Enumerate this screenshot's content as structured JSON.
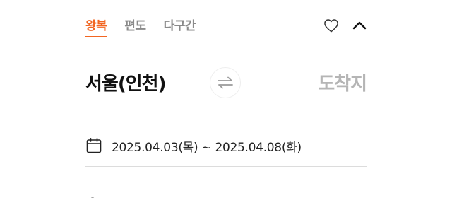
{
  "trip_tabs": [
    {
      "label": "왕복",
      "active": true
    },
    {
      "label": "편도",
      "active": false
    },
    {
      "label": "다구간",
      "active": false
    }
  ],
  "icons": {
    "favorite": "heart-outline-icon",
    "collapse": "chevron-up-icon",
    "swap": "swap-arrows-icon",
    "calendar": "calendar-icon"
  },
  "route": {
    "origin": "서울(인천)",
    "destination": "도착지"
  },
  "dates": {
    "range": "2025.04.03(목) ~ 2025.04.08(화)"
  },
  "colors": {
    "accent": "#f26622",
    "text_primary": "#111111",
    "text_muted": "#8a8a8a",
    "placeholder": "#b5b5b5"
  }
}
